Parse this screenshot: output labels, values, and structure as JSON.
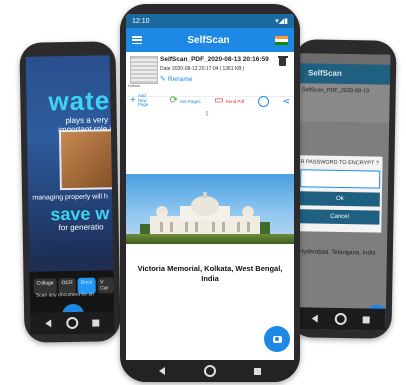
{
  "left_phone": {
    "headline": "water",
    "subline": "plays a very important role in our daily life",
    "managing": "managing properly will h",
    "save": "save w",
    "for_gen": "for generatio",
    "modes": [
      "Collage",
      "OCR",
      "Docs",
      "V Car"
    ],
    "active_mode": "Docs",
    "scan_hint": "Scan any document for sh"
  },
  "center_phone": {
    "status_time": "12:10",
    "app_title": "SelfScan",
    "doc": {
      "name": "SelfScan_PDF_2020-08-13 20:16:59",
      "meta": "Date 2020-08-13 20:17:04 | 1361 KB |",
      "rename_label": "Rename",
      "thumb_caption": "Kolkata..."
    },
    "actions": [
      {
        "label": "Add New Page",
        "icon": "+"
      },
      {
        "label": "Set Pages",
        "icon": "⟳"
      },
      {
        "label": "Send Pdf",
        "icon": "▭"
      }
    ],
    "caption": "Victoria Memorial, Kolkata, West Bengal, India"
  },
  "right_phone": {
    "app_title": "SelfScan",
    "doc_name": "SelfScan_PDF_2020-08-13",
    "dialog_question": "R PASSWORD TO ENCRYPT ?",
    "ok_label": "Ok",
    "cancel_label": "Cancel",
    "location": "Hyderabad, Telangana, India"
  },
  "colors": {
    "primary": "#1e88e5",
    "status_dark": "#1a6aa0",
    "water_cyan": "#3ed3f2",
    "dialog_button": "#1f5f80"
  }
}
